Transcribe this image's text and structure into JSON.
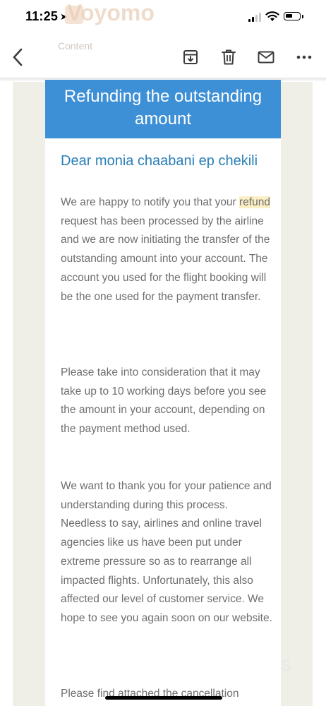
{
  "status_bar": {
    "time": "11:25",
    "location_icon": "location-arrow-icon",
    "signal_icon": "cellular-signal-icon",
    "wifi_icon": "wifi-icon",
    "battery_icon": "battery-icon"
  },
  "background_header": {
    "brand": "Voyomo",
    "subtitle": "Content"
  },
  "toolbar": {
    "back_icon": "chevron-left-icon",
    "archive_icon": "archive-icon",
    "delete_icon": "trash-icon",
    "mark_icon": "mail-icon",
    "more_icon": "more-horizontal-icon"
  },
  "email": {
    "header_line1": "Refunding the outstanding",
    "header_line2": "amount",
    "header_color": "#3d8fd6",
    "greeting": "Dear monia chaabani ep chekili",
    "p1_before": "We are happy to notify you that your ",
    "p1_highlight": "refund",
    "p1_after": " request has been processed by the airline and we are now initiating the transfer of the outstanding amount into your account. The account you used for the flight booking will be the one used for the payment transfer.",
    "p2": "Please take into consideration that it may take up to 10 working days before you see the amount in your account, depending on the payment method used.",
    "p3": "We want to thank you for your patience and understanding during this process. Needless to say, airlines and online travel agencies like us have been put under extreme pressure so as to rearrange all impacted flights. Unfortunately, this also affected our level of customer service. We hope to see you again soon on our website.",
    "p4": "Please find attached the cancellation"
  }
}
